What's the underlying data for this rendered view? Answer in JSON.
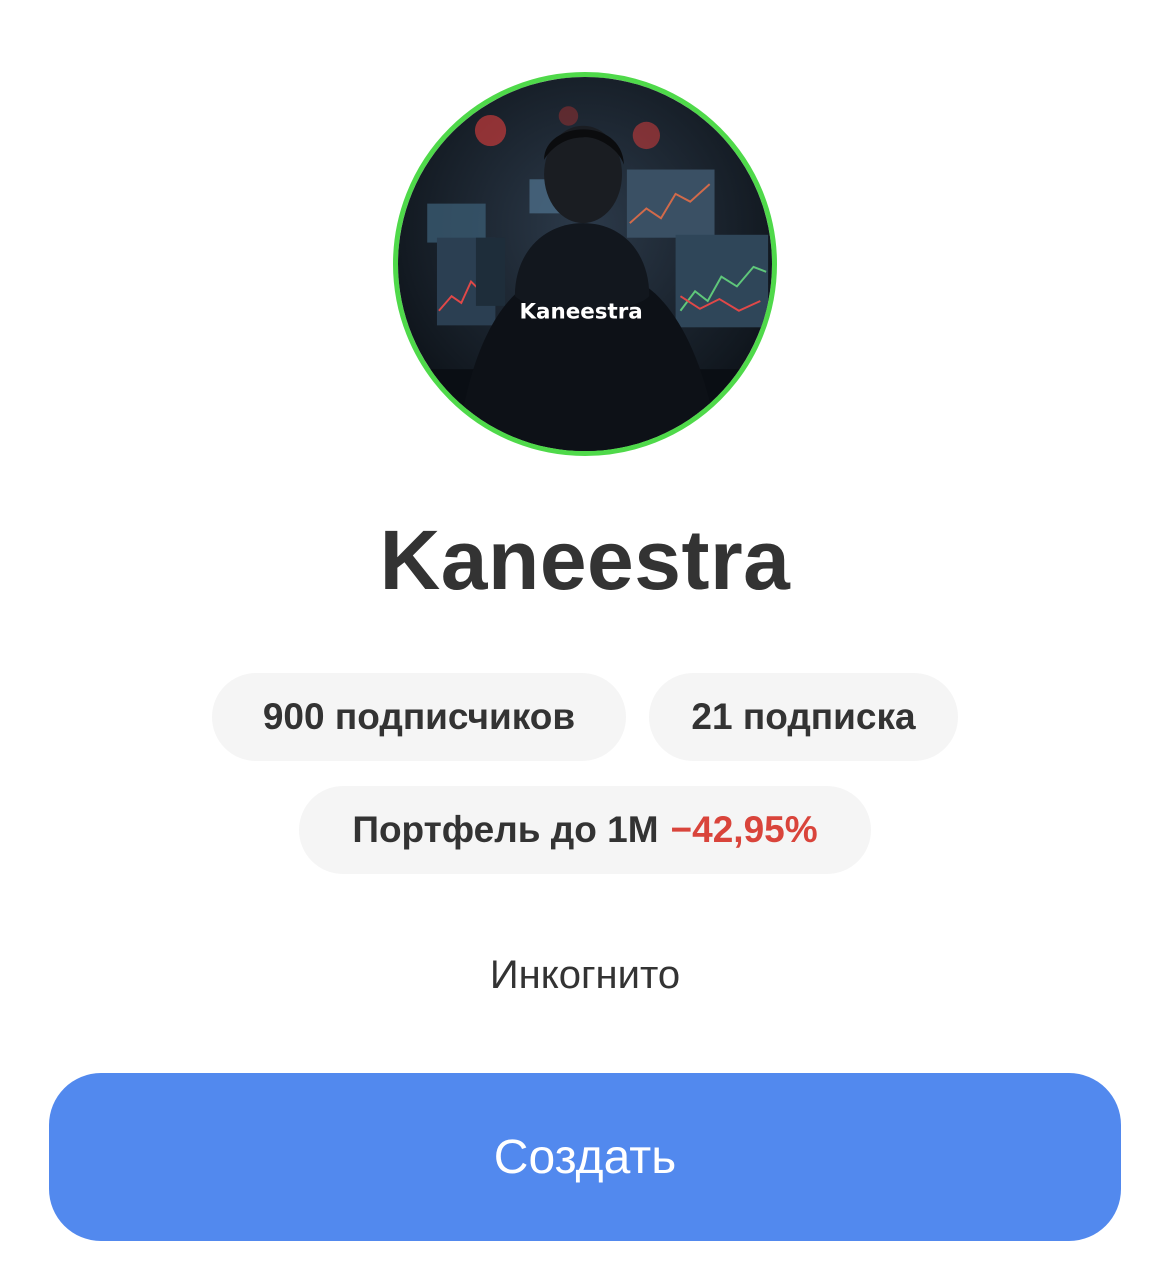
{
  "profile": {
    "avatar_name": "avatar",
    "avatar_caption": "Kaneestra",
    "name": "Kaneestra",
    "accent_ring_color": "#4fd94a"
  },
  "stats": {
    "followers": "900 подписчиков",
    "following": "21 подписка"
  },
  "portfolio": {
    "label": "Портфель до 1М",
    "change": "−42,95%",
    "change_color": "#d9443b"
  },
  "privacy": {
    "label": "Инкогнито"
  },
  "actions": {
    "create_label": "Создать",
    "create_color": "#5289ee"
  }
}
